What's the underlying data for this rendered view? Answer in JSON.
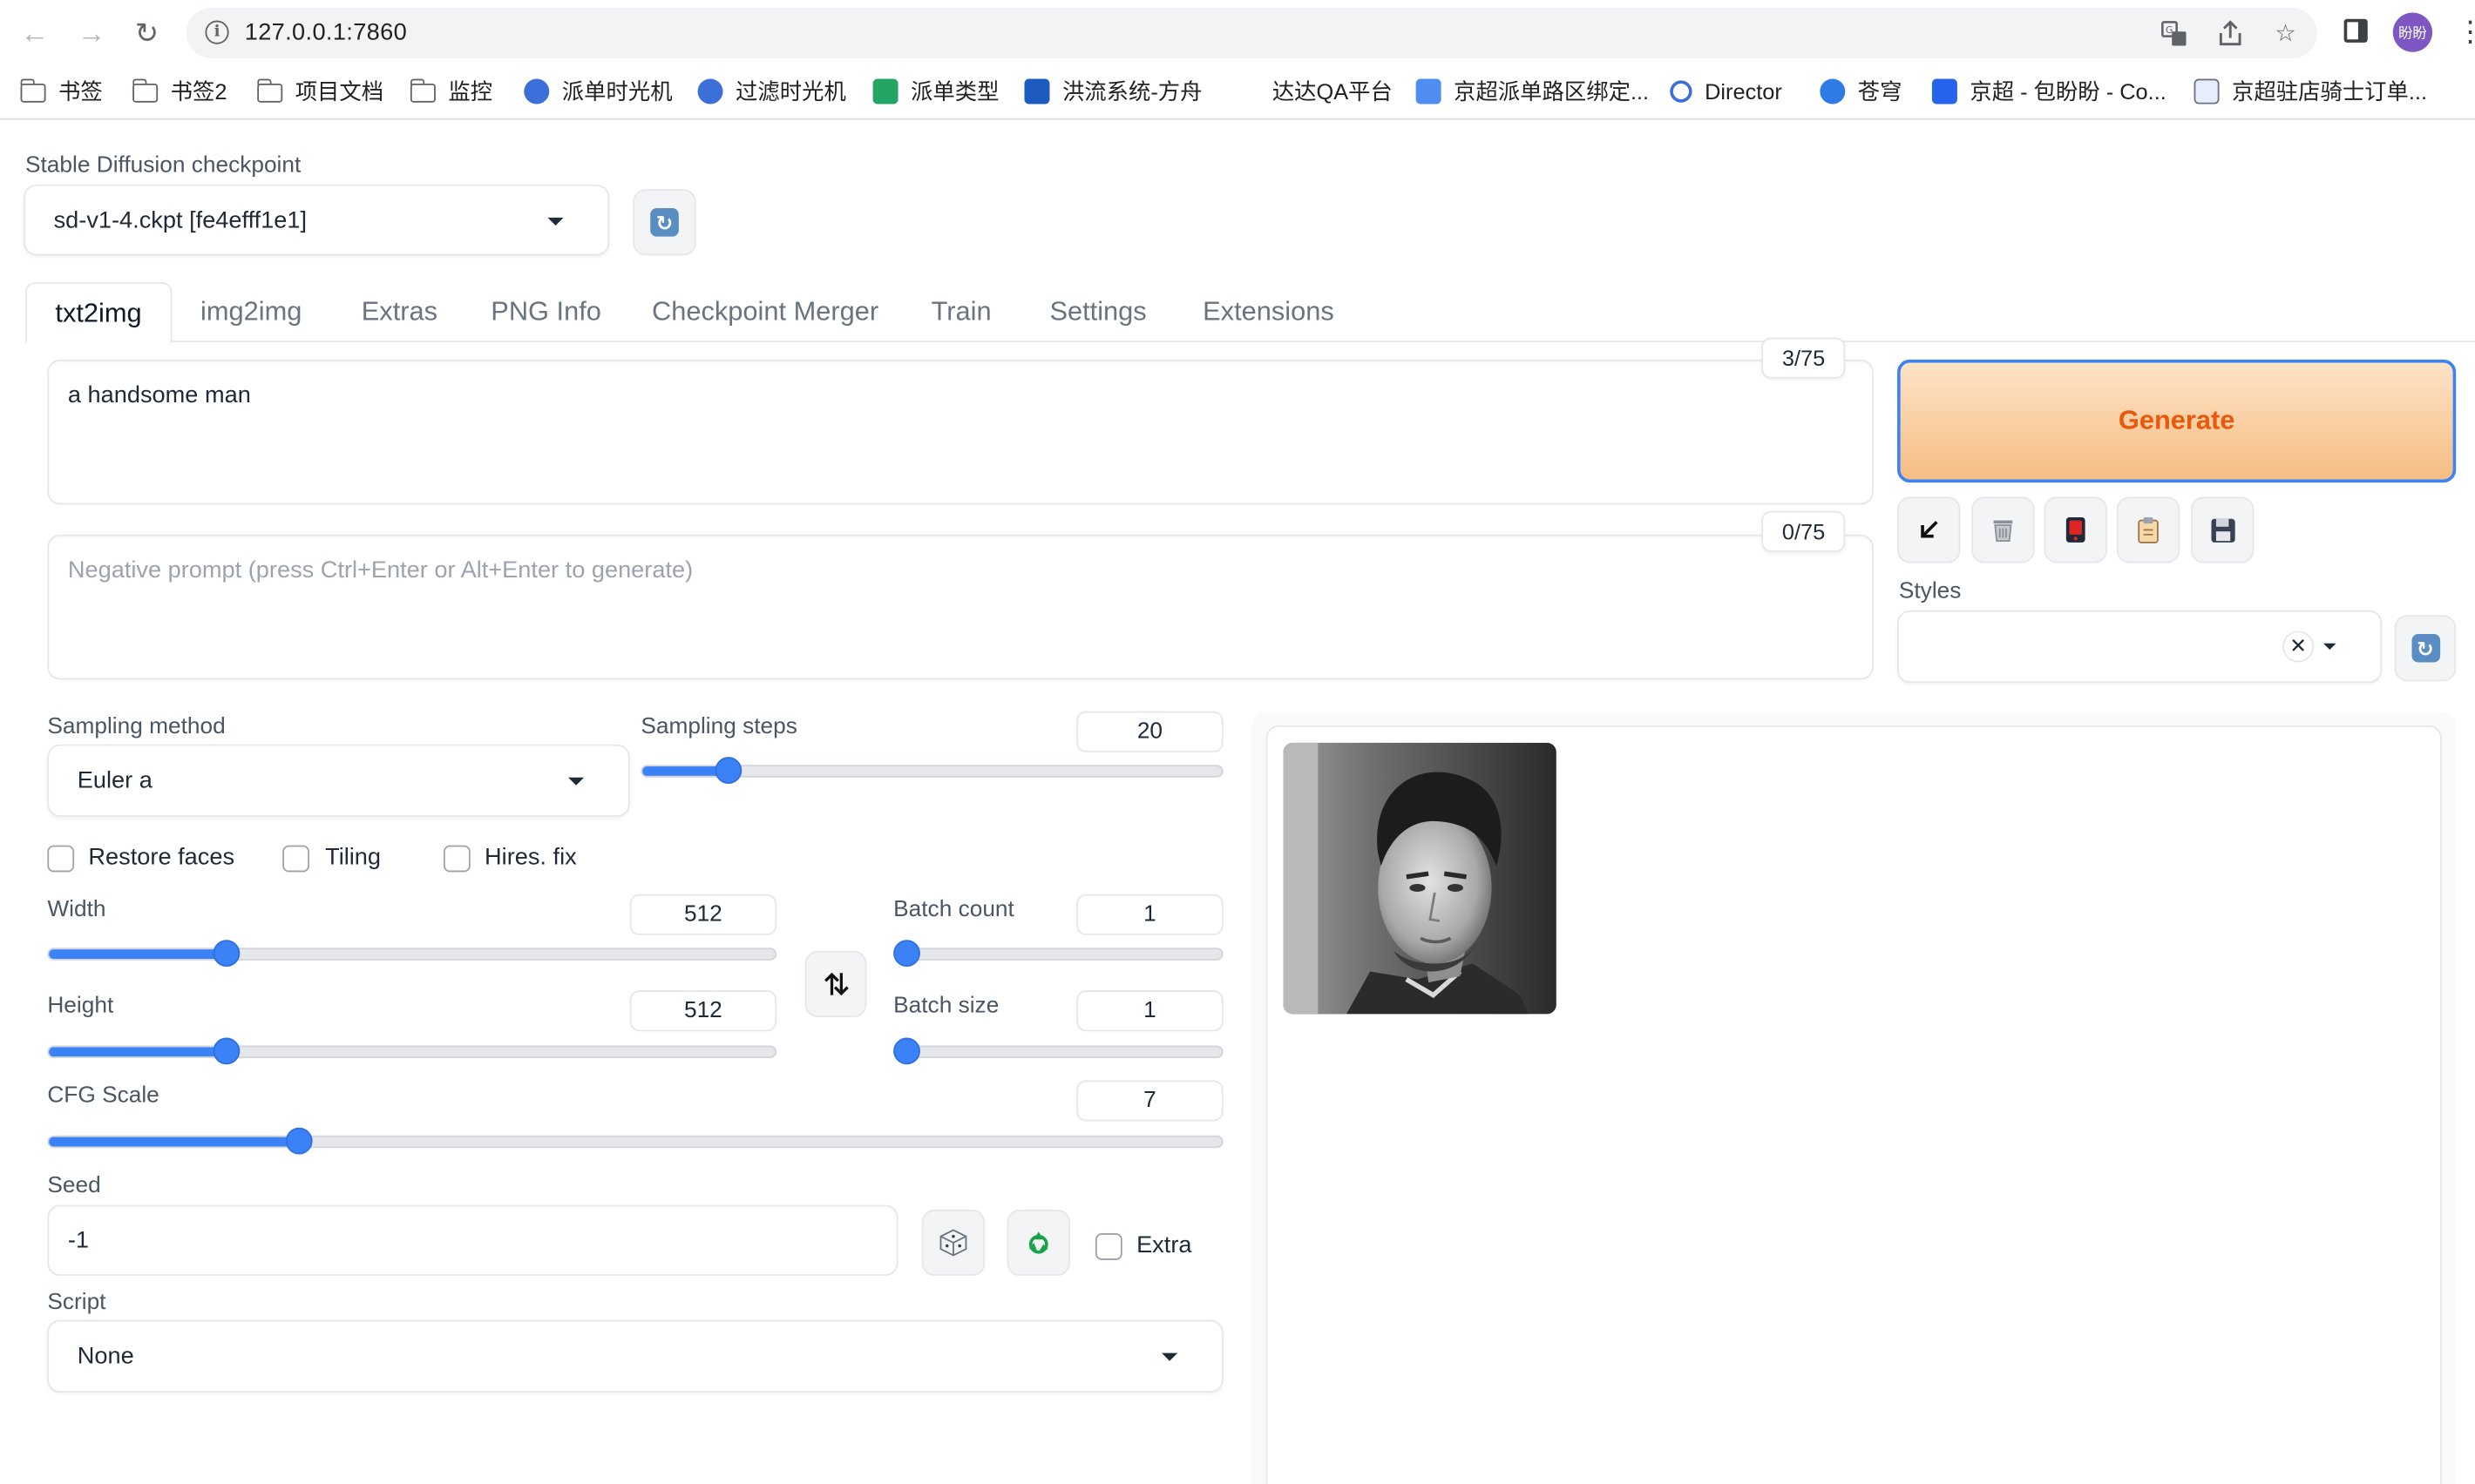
{
  "browser": {
    "url": "127.0.0.1:7860",
    "profile_initials": "盼盼",
    "bookmarks": [
      {
        "label": "书签",
        "icon": "folder-icon"
      },
      {
        "label": "书签2",
        "icon": "folder-icon"
      },
      {
        "label": "项目文档",
        "icon": "folder-icon"
      },
      {
        "label": "监控",
        "icon": "folder-icon"
      },
      {
        "label": "派单时光机",
        "icon": "app-icon"
      },
      {
        "label": "过滤时光机",
        "icon": "app-icon"
      },
      {
        "label": "派单类型",
        "icon": "sheet-icon"
      },
      {
        "label": "洪流系统-方舟",
        "icon": "app-icon"
      },
      {
        "label": "达达QA平台",
        "icon": "none"
      },
      {
        "label": "京超派单路区绑定...",
        "icon": "app-icon"
      },
      {
        "label": "Director",
        "icon": "app-icon"
      },
      {
        "label": "苍穹",
        "icon": "app-icon"
      },
      {
        "label": "京超 - 包盼盼 - Co...",
        "icon": "app-icon"
      },
      {
        "label": "京超驻店骑士订单...",
        "icon": "app-icon"
      }
    ]
  },
  "checkpoint": {
    "label": "Stable Diffusion checkpoint",
    "value": "sd-v1-4.ckpt [fe4efff1e1]"
  },
  "tabs": [
    "txt2img",
    "img2img",
    "Extras",
    "PNG Info",
    "Checkpoint Merger",
    "Train",
    "Settings",
    "Extensions"
  ],
  "prompt": {
    "value": "a handsome man",
    "token_count": "3/75"
  },
  "negative_prompt": {
    "placeholder": "Negative prompt (press Ctrl+Enter or Alt+Enter to generate)",
    "token_count": "0/75"
  },
  "generate_label": "Generate",
  "styles": {
    "label": "Styles"
  },
  "sampling": {
    "method_label": "Sampling method",
    "method_value": "Euler a",
    "steps_label": "Sampling steps",
    "steps_value": "20",
    "steps_fraction": 0.1333
  },
  "options": {
    "restore_faces": "Restore faces",
    "tiling": "Tiling",
    "hires_fix": "Hires. fix"
  },
  "size": {
    "width_label": "Width",
    "width_value": "512",
    "width_fraction": 0.2353,
    "height_label": "Height",
    "height_value": "512",
    "height_fraction": 0.2353
  },
  "batch": {
    "count_label": "Batch count",
    "count_value": "1",
    "count_fraction": 0.0,
    "size_label": "Batch size",
    "size_value": "1",
    "size_fraction": 0.0
  },
  "cfg": {
    "label": "CFG Scale",
    "value": "7",
    "fraction": 0.2069
  },
  "seed": {
    "label": "Seed",
    "value": "-1",
    "extra_label": "Extra"
  },
  "script": {
    "label": "Script",
    "value": "None"
  },
  "colors": {
    "accent": "#3b82f6",
    "generate_text": "#ea580c"
  }
}
